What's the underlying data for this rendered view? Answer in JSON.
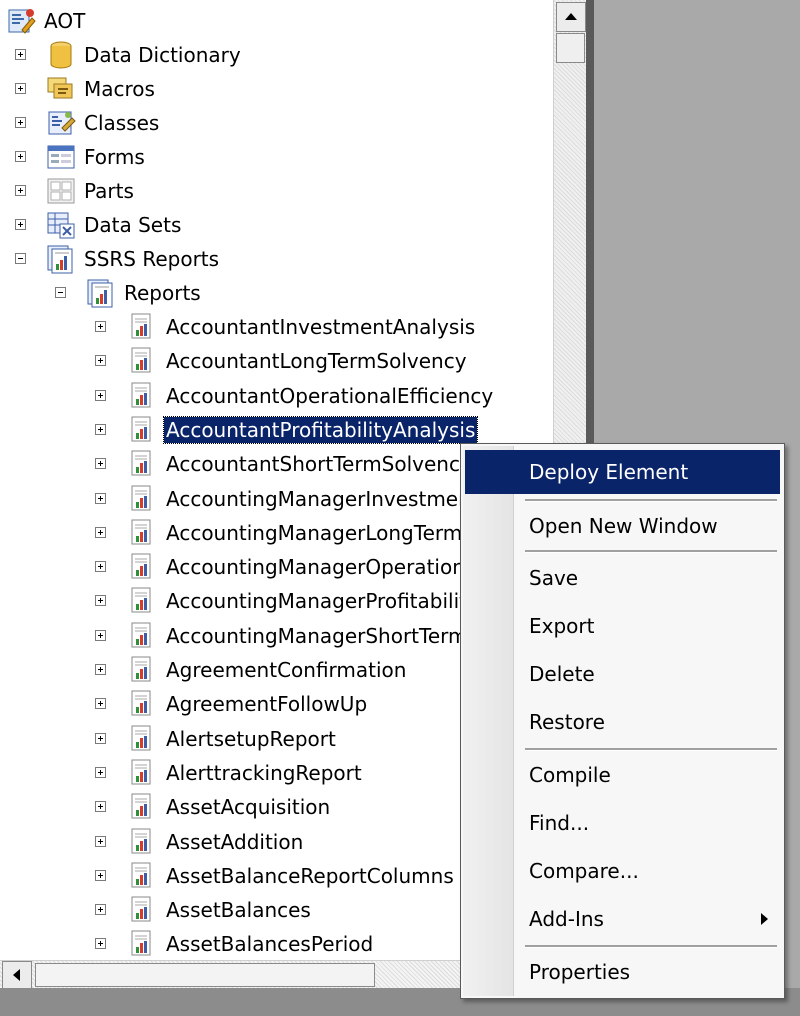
{
  "tree": {
    "root": "AOT",
    "top_nodes": [
      {
        "label": "Data Dictionary",
        "icon": "database-icon"
      },
      {
        "label": "Macros",
        "icon": "macros-icon"
      },
      {
        "label": "Classes",
        "icon": "classes-icon"
      },
      {
        "label": "Forms",
        "icon": "forms-icon"
      },
      {
        "label": "Parts",
        "icon": "parts-icon"
      },
      {
        "label": "Data Sets",
        "icon": "datasets-icon"
      },
      {
        "label": "SSRS Reports",
        "icon": "report-folder-icon"
      }
    ],
    "reports_node": "Reports",
    "reports": [
      "AccountantInvestmentAnalysis",
      "AccountantLongTermSolvency",
      "AccountantOperationalEfficiency",
      "AccountantProfitabilityAnalysis",
      "AccountantShortTermSolvency",
      "AccountingManagerInvestmen",
      "AccountingManagerLongTermS",
      "AccountingManagerOperationa",
      "AccountingManagerProfitability",
      "AccountingManagerShortTerm",
      "AgreementConfirmation",
      "AgreementFollowUp",
      "AlertsetupReport",
      "AlerttrackingReport",
      "AssetAcquisition",
      "AssetAddition",
      "AssetBalanceReportColumns",
      "AssetBalances",
      "AssetBalancesPeriod"
    ],
    "selected_report": "AccountantProfitabilityAnalysis"
  },
  "context_menu": {
    "items": [
      {
        "label": "Deploy Element",
        "active": true
      },
      {
        "label": "Open New Window"
      },
      {
        "label": "Save"
      },
      {
        "label": "Export"
      },
      {
        "label": "Delete"
      },
      {
        "label": "Restore"
      },
      {
        "label": "Compile"
      },
      {
        "label": "Find..."
      },
      {
        "label": "Compare..."
      },
      {
        "label": "Add-Ins",
        "submenu": true
      },
      {
        "label": "Properties"
      }
    ]
  },
  "colors": {
    "selection": "#0a246a",
    "selection_text": "#ffffff",
    "background": "#ffffff"
  }
}
